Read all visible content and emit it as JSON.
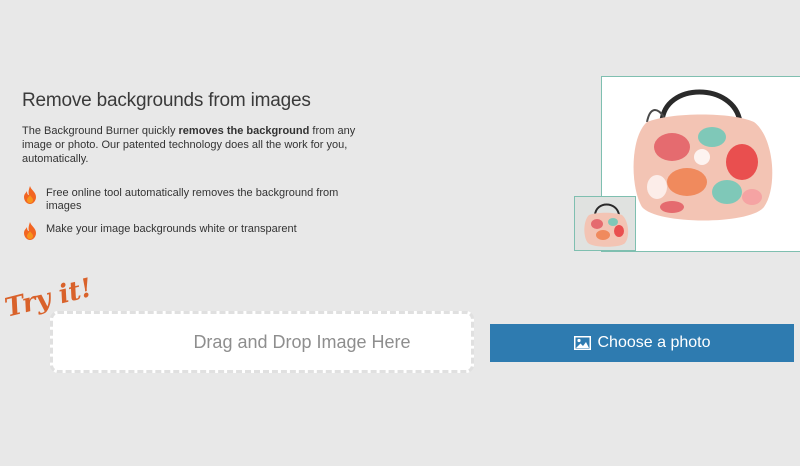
{
  "header": {
    "title": "Remove backgrounds from images"
  },
  "intro": {
    "part1": "The Background Burner quickly ",
    "bold": "removes the background",
    "part2": " from any image or photo. Our patented technology does all the work for you, automatically."
  },
  "features": [
    {
      "text": "Free online tool automatically removes the background from images",
      "icon": "flame-icon"
    },
    {
      "text": "Make your image backgrounds white or transparent",
      "icon": "flame-icon"
    }
  ],
  "try_it": {
    "text": "Try it!"
  },
  "upload": {
    "dropzone_label": "Drag and Drop Image Here",
    "choose_label": "Choose a photo",
    "choose_icon": "image-icon"
  },
  "colors": {
    "accent": "#2e7bb0",
    "flame": "#f26522",
    "try_it": "#d9622b",
    "preview_border": "#7fbfb0"
  }
}
